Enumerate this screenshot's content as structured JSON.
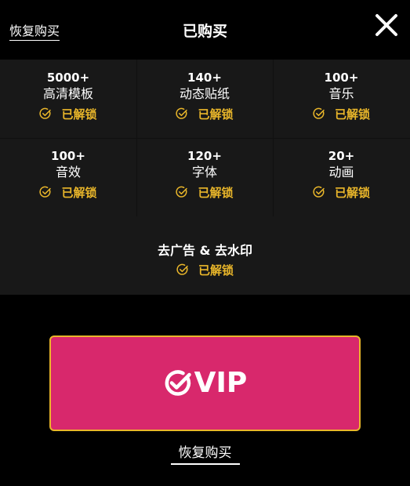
{
  "header": {
    "restore_link": "恢复购买",
    "title": "已购买",
    "close_icon": "close-icon"
  },
  "features": [
    {
      "count": "5000+",
      "name": "高清模板",
      "status": "已解锁"
    },
    {
      "count": "140+",
      "name": "动态贴纸",
      "status": "已解锁"
    },
    {
      "count": "100+",
      "name": "音乐",
      "status": "已解锁"
    },
    {
      "count": "100+",
      "name": "音效",
      "status": "已解锁"
    },
    {
      "count": "120+",
      "name": "字体",
      "status": "已解锁"
    },
    {
      "count": "20+",
      "name": "动画",
      "status": "已解锁"
    }
  ],
  "extra_feature": {
    "name": "去广告 & 去水印",
    "status": "已解锁"
  },
  "vip_button": {
    "label": "VIP",
    "icon": "check-circle-icon"
  },
  "footer": {
    "restore_link": "恢复购买"
  },
  "colors": {
    "background": "#000000",
    "panel": "#181818",
    "accent_gold": "#e9b62a",
    "vip_pink": "#d8286c"
  }
}
